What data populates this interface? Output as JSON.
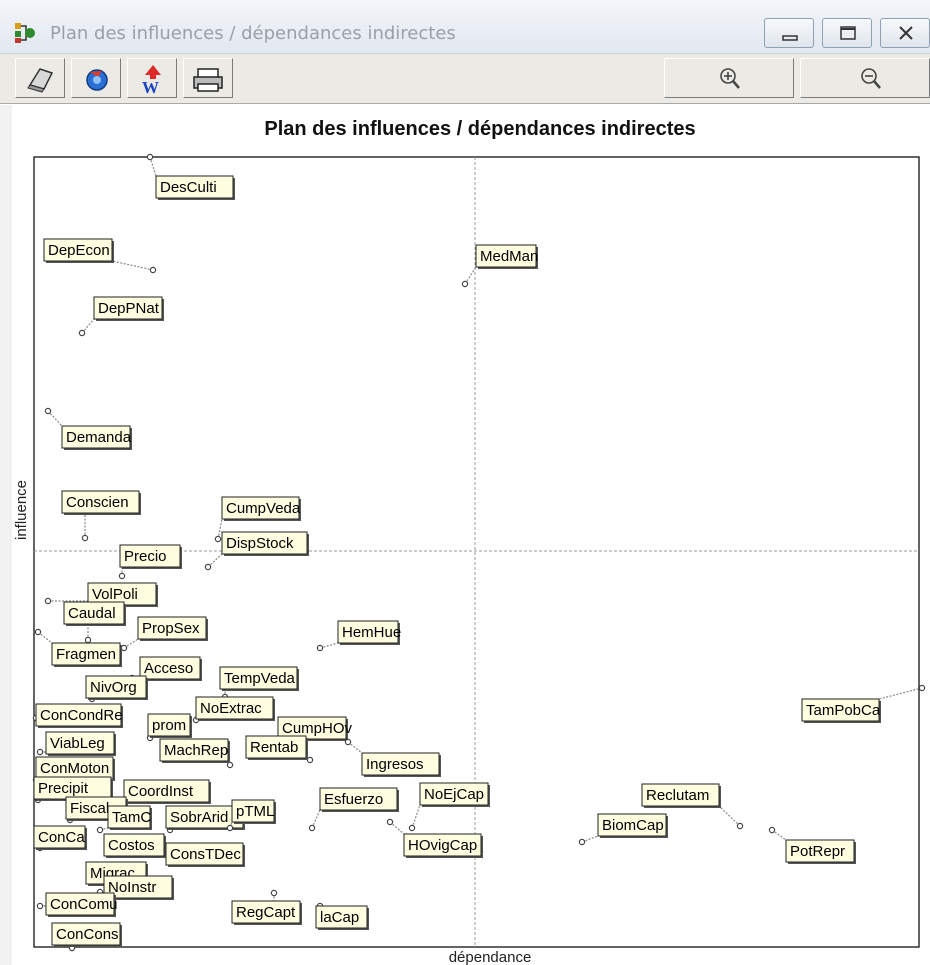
{
  "window": {
    "title": "Plan des influences / dépendances indirectes",
    "controls": [
      "minimize-icon",
      "maximize-icon",
      "close-icon"
    ]
  },
  "toolbar": {
    "buttons": [
      "copy-icon",
      "refresh-icon",
      "export-word-icon",
      "print-icon"
    ],
    "zoom": [
      "zoom-in-icon",
      "zoom-out-icon"
    ]
  },
  "colors": {
    "label_fill": "#fffde0",
    "label_border": "#222222",
    "leader": "#888888",
    "quadrant_line": "#999999"
  },
  "chart_data": {
    "type": "scatter",
    "title": "Plan des influences / dépendances indirectes",
    "xlabel": "dépendance",
    "ylabel": "influence",
    "grid": "quadrant lines (dashed)",
    "points": [
      {
        "label": "DesCulti"
      },
      {
        "label": "DepEcon"
      },
      {
        "label": "MedMan"
      },
      {
        "label": "DepPNat"
      },
      {
        "label": "Demanda"
      },
      {
        "label": "Conscien"
      },
      {
        "label": "CumpVeda"
      },
      {
        "label": "DispStock"
      },
      {
        "label": "Precio"
      },
      {
        "label": "VolPoli"
      },
      {
        "label": "Caudal"
      },
      {
        "label": "PropSex"
      },
      {
        "label": "HemHue"
      },
      {
        "label": "Fragmen"
      },
      {
        "label": "Acceso"
      },
      {
        "label": "NivOrg"
      },
      {
        "label": "TempVeda"
      },
      {
        "label": "ConCondRe"
      },
      {
        "label": "NoExtrac"
      },
      {
        "label": "prom"
      },
      {
        "label": "CumpHOv"
      },
      {
        "label": "ViabLeg"
      },
      {
        "label": "MachRep"
      },
      {
        "label": "Rentab"
      },
      {
        "label": "Ingresos"
      },
      {
        "label": "ConMoton"
      },
      {
        "label": "Precipit"
      },
      {
        "label": "CoordInst"
      },
      {
        "label": "Esfuerzo"
      },
      {
        "label": "NoEjCap"
      },
      {
        "label": "Fiscal"
      },
      {
        "label": "TamC"
      },
      {
        "label": "SobrArid"
      },
      {
        "label": "pTML"
      },
      {
        "label": "ConCa"
      },
      {
        "label": "Costos"
      },
      {
        "label": "ConsTDec"
      },
      {
        "label": "HOvigCap"
      },
      {
        "label": "Migrac"
      },
      {
        "label": "NoInstr"
      },
      {
        "label": "ConComu"
      },
      {
        "label": "RegCapt"
      },
      {
        "label": "laCap"
      },
      {
        "label": "ConCons"
      },
      {
        "label": "TamPobCa"
      },
      {
        "label": "Reclutam"
      },
      {
        "label": "BiomCap"
      },
      {
        "label": "PotRepr"
      }
    ]
  }
}
